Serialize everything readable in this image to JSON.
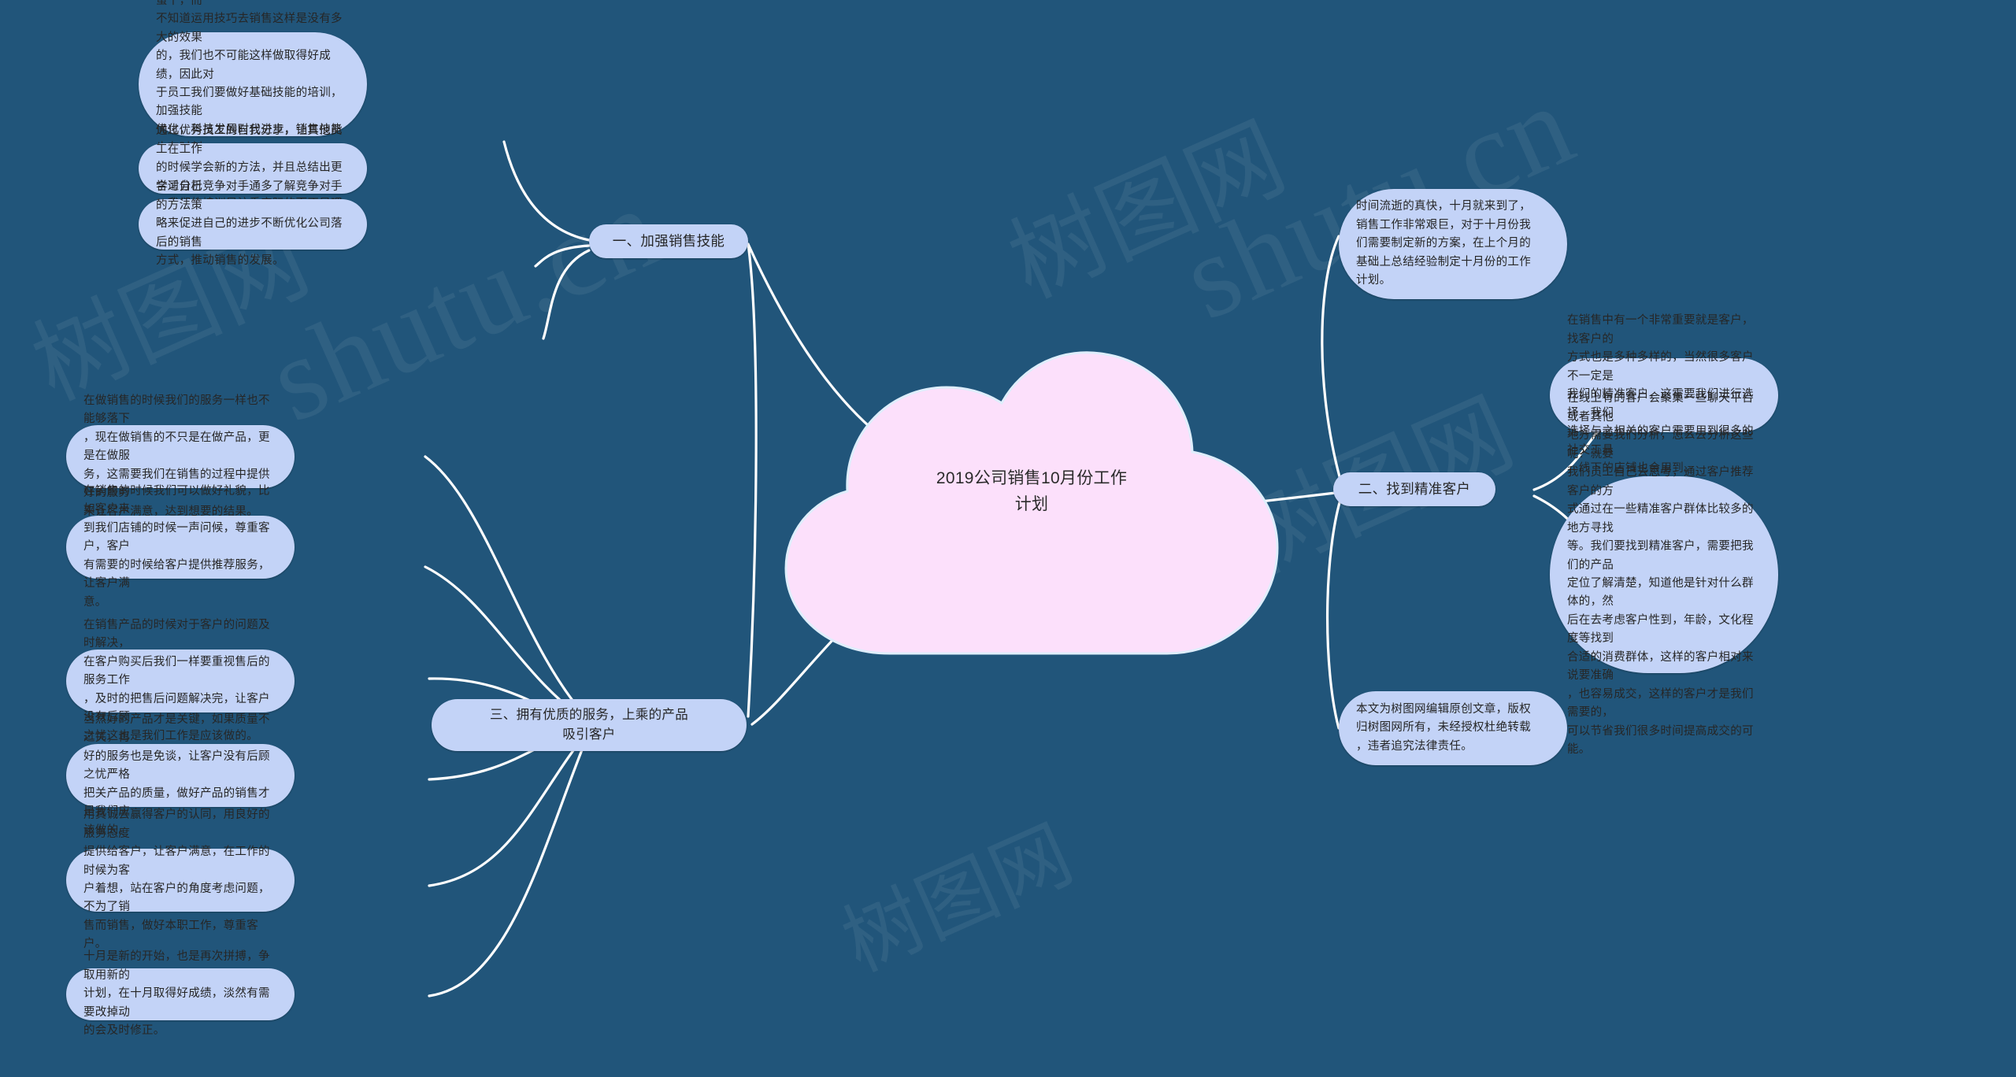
{
  "meta": {
    "bg_color": "#21557a",
    "node_fill": "#c3d3f7",
    "center_fill": "#fce0fb",
    "line_color": "#ffffff",
    "text_color": "#262626"
  },
  "watermarks": [
    "shutu.cn",
    "树图网 shutu.cn",
    "树图网",
    "树图网"
  ],
  "center": {
    "title": "2019公司销售10月份工作\n计划"
  },
  "branches": [
    {
      "id": "b1",
      "label": "一、加强销售技能",
      "children": [
        {
          "id": "b1c1",
          "text": "磨刀不误砍柴功，在我们做销售的时候销售技\n巧，技能是非常关键的，如果只知道蛮干，而\n不知道运用技巧去销售这样是没有多大的效果\n的，我们也不可能这样做取得好成绩，因此对\n于员工我们要做好基础技能的培训，加强技能\n优化，科技发展时代进步，销售技能也在时刻\n更新，做好更新很重要，当然也要结合实际来\n，我们的培训是注重实际的而不是理论的。"
        },
        {
          "id": "b1c2",
          "text": "通过优秀员工的自我分享，让其他员工在工作\n的时候学会新的方法，并且总结出更合适自己\n工作的方式。"
        },
        {
          "id": "b1c3",
          "text": "学习分析竞争对手通多了解竞争对手的方法策\n略来促进自己的进步不断优化公司落后的销售\n方式，推动销售的发展。"
        }
      ]
    },
    {
      "id": "b2",
      "label": "三、拥有优质的服务，上乘的产品\n吸引客户",
      "children": [
        {
          "id": "b2c1",
          "text": "在做销售的时候我们的服务一样也不能够落下\n，现在做销售的不只是在做产品，更是在做服\n务，这需要我们在销售的过程中提供好的服务\n来让客户满意，达到想要的结果。"
        },
        {
          "id": "b2c2",
          "text": "在销售的时候我们可以做好礼貌，比如客户来\n到我们店铺的时候一声问候，尊重客户，客户\n有需要的时候给客户提供推荐服务，让客户满\n意。"
        },
        {
          "id": "b2c3",
          "text": "在销售产品的时候对于客户的问题及时解决，\n在客户购买后我们一样要重视售后的服务工作\n，及时的把售后问题解决完，让客户没有后顾\n之忧这也是我们工作是应该做的。"
        },
        {
          "id": "b2c4",
          "text": "当然好的产品才是关键，如果质量不过关，再\n好的服务也是免谈，让客户没有后顾之忧严格\n把关产品的质量，做好产品的销售才是我们应\n该做的。"
        },
        {
          "id": "b2c5",
          "text": "用真诚去赢得客户的认同，用良好的服务态度\n提供给客户，让客户满意，在工作的时候为客\n户着想，站在客户的角度考虑问题，不为了销\n售而销售，做好本职工作，尊重客户。"
        },
        {
          "id": "b2c6",
          "text": "十月是新的开始，也是再次拼搏，争取用新的\n计划，在十月取得好成绩，淡然有需要改掉动\n的会及时修正。"
        }
      ]
    },
    {
      "id": "b3",
      "label": "二、找到精准客户",
      "children": [
        {
          "id": "b3c1",
          "text": "在销售中有一个非常重要就是客户，找客户的\n方式也是多种多样的，当然很多客户不一定是\n我们的精准客户，这需要我们进行选择，我们\n选择与之相关的客户需要用到很多的社交工具\n，线下的店铺也会用到。"
        },
        {
          "id": "b3c2",
          "text": "在线上有的客户会聚集一些聊天平台或者其他\n地方需要我们分析，怎么去分析这些呢？就要\n我们员工自己去思考，通过客户推荐客户的方\n式通过在一些精准客户群体比较多的地方寻找\n等。我们要找到精准客户，需要把我们的产品\n定位了解清楚，知道他是针对什么群体的，然\n后在去考虑客户性到，年龄，文化程度等找到\n合适的消费群体，这样的客户相对来说要准确\n，也容易成交，这样的客户才是我们需要的，\n可以节省我们很多时间提高成交的可能。"
        }
      ]
    }
  ],
  "intro_note": "时间流逝的真快，十月就来到了，\n销售工作非常艰巨，对于十月份我\n们需要制定新的方案，在上个月的\n基础上总结经验制定十月份的工作\n计划。",
  "copyright_note": "本文为树图网编辑原创文章，版权\n归树图网所有，未经授权杜绝转载\n，违者追究法律责任。"
}
